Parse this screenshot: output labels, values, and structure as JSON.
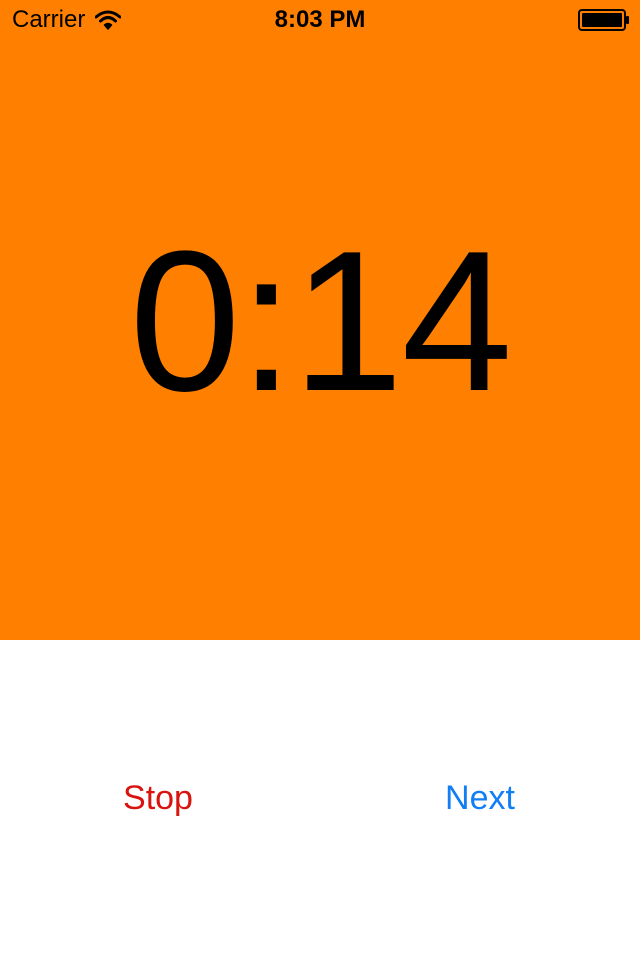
{
  "status_bar": {
    "carrier": "Carrier",
    "time": "8:03 PM",
    "wifi_icon": "wifi-icon",
    "battery_icon": "battery-full-icon"
  },
  "timer": {
    "display": "0:14",
    "background_color": "#FF8000"
  },
  "controls": {
    "stop_label": "Stop",
    "stop_color": "#D9140F",
    "next_label": "Next",
    "next_color": "#127EF4"
  }
}
